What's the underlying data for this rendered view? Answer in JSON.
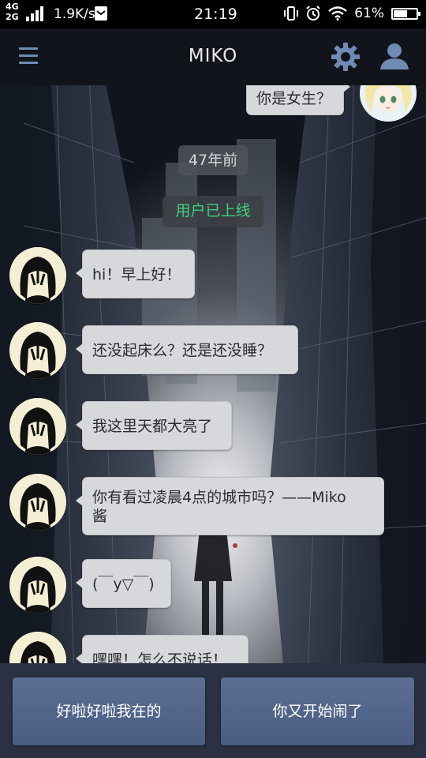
{
  "status_bar": {
    "network_top": "4G",
    "network_bottom": "2G",
    "speed": "1.9K/s",
    "time": "21:19",
    "battery": "61%",
    "battery_level": 0.61,
    "icons": [
      "signal-icon",
      "mail-icon",
      "vibrate-icon",
      "alarm-icon",
      "wifi-icon",
      "battery-icon"
    ]
  },
  "header": {
    "title": "MIKO",
    "accent_color": "#6f8bb4",
    "icons": [
      "menu-icon",
      "gear-icon",
      "user-icon"
    ]
  },
  "chat": {
    "top_message": "你是女生？",
    "time_divider": "47年前",
    "system_notice": "用户已上线",
    "messages": [
      {
        "text": "hi！早上好！"
      },
      {
        "text": "还没起床么？还是还没睡？"
      },
      {
        "text": "我这里天都大亮了"
      },
      {
        "line1": "你有看过凌晨4点的城市吗？——Miko",
        "line2": "酱"
      },
      {
        "text": "(￣y▽￣)"
      },
      {
        "text": "嘿嘿！怎么不说话！"
      }
    ]
  },
  "replies": {
    "option1": "好啦好啦我在的",
    "option2": "你又开始闹了"
  },
  "colors": {
    "bubble": "#d7d8dc",
    "online_text": "#3ed07a",
    "reply_button": "#5b6e93",
    "bottom_bar": "#2a3142"
  }
}
